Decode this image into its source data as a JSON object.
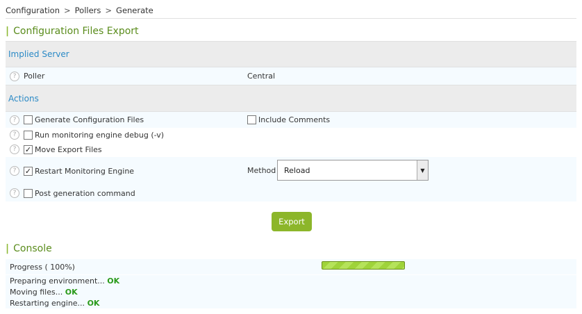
{
  "breadcrumb": {
    "items": [
      "Configuration",
      "Pollers",
      "Generate"
    ],
    "separator": ">"
  },
  "export_section": {
    "title": "Configuration Files Export"
  },
  "implied_server": {
    "header": "Implied Server",
    "poller_label": "Poller",
    "poller_value": "Central"
  },
  "actions": {
    "header": "Actions",
    "generate_config": {
      "label": "Generate Configuration Files",
      "checked": false
    },
    "include_comments": {
      "label": "Include Comments",
      "checked": false
    },
    "debug": {
      "label": "Run monitoring engine debug (-v)",
      "checked": false
    },
    "move_export": {
      "label": "Move Export Files",
      "checked": true
    },
    "restart": {
      "label": "Restart Monitoring Engine",
      "checked": true
    },
    "method_label": "Method",
    "method_value": "Reload",
    "post_generation": {
      "label": "Post generation command",
      "checked": false
    }
  },
  "export_button": {
    "label": "Export"
  },
  "console": {
    "title": "Console",
    "progress_label": "Progress ( 100%)",
    "progress_fraction": 1.0,
    "log": [
      {
        "text": "Preparing environment...",
        "status": "OK"
      },
      {
        "text": "Moving files...",
        "status": "OK"
      },
      {
        "text": "Restarting engine...",
        "status": "OK"
      }
    ]
  },
  "icons": {
    "help": "question-circle-icon",
    "check": "✓",
    "dropdown": "▼"
  },
  "colors": {
    "accent_green": "#8cb62a",
    "title_green": "#5a8c1c",
    "link_blue": "#2b8ac6",
    "ok_green": "#2a9a1a"
  }
}
